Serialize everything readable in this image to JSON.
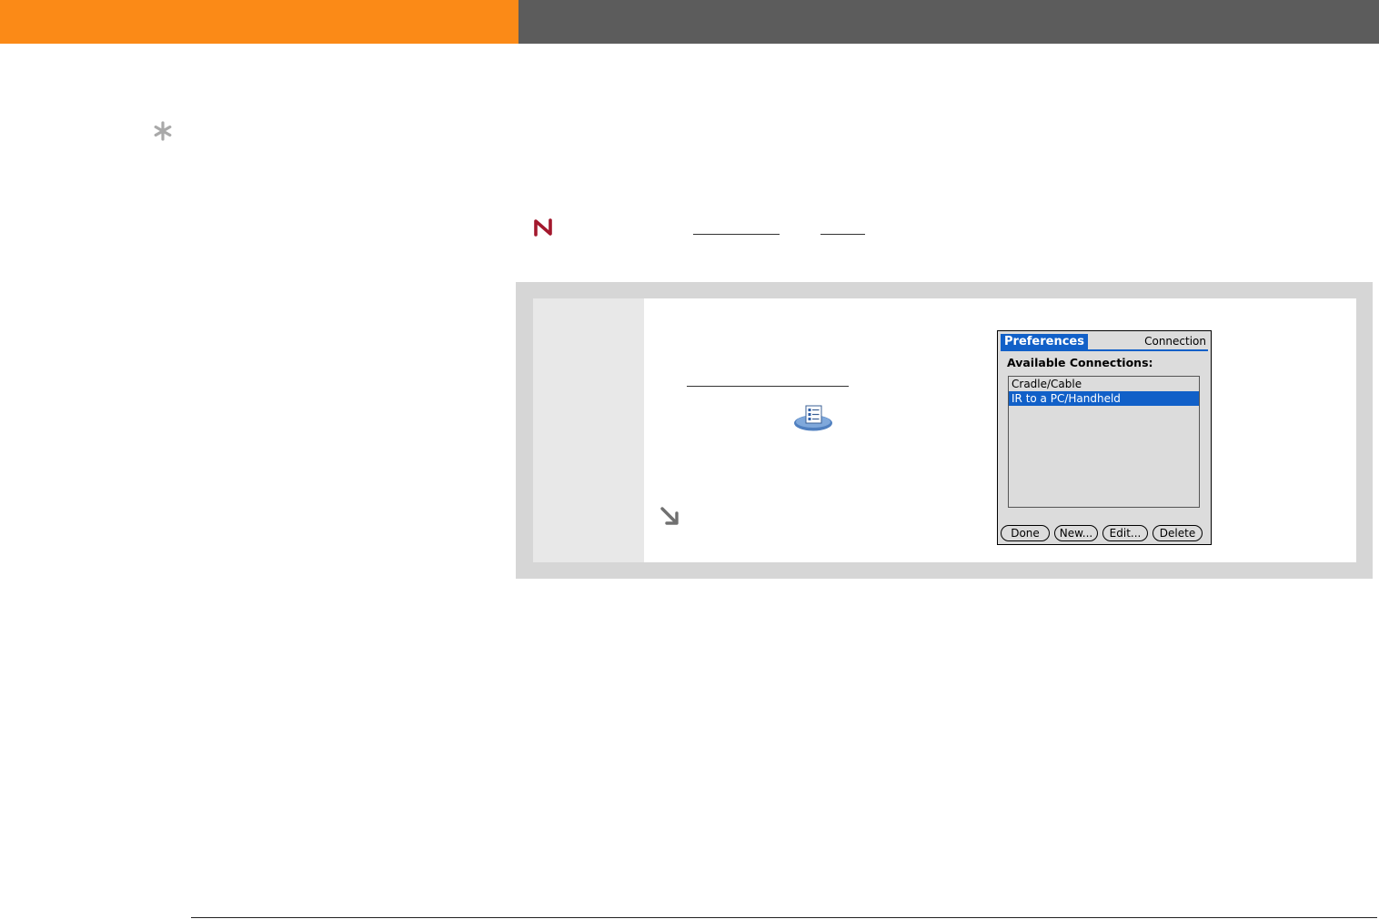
{
  "device_screen": {
    "tab_title": "Preferences",
    "app_name": "Connection",
    "list_label": "Available Connections:",
    "connections": [
      "Cradle/Cable",
      "IR to a PC/Handheld"
    ],
    "selected_index": 1,
    "buttons": {
      "done": "Done",
      "new": "New...",
      "edit": "Edit...",
      "delete": "Delete"
    }
  },
  "icons": {
    "tip": "asterisk-icon",
    "note": "note-icon",
    "preferences": "preferences-app-icon",
    "continue": "arrow-down-right-icon"
  },
  "colors": {
    "header_accent": "#fb8a17",
    "header_dark": "#5c5c5c",
    "palm_highlight": "#1160c8"
  }
}
